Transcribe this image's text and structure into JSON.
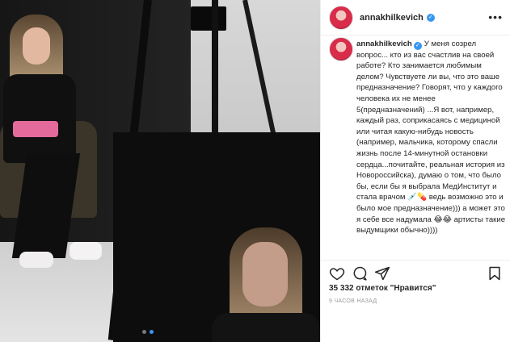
{
  "post": {
    "username": "annakhilkevich",
    "verified_mark": "✓",
    "more_icon": "•••",
    "caption": "У меня созрел вопрос... кто из вас счастлив на своей работе? Кто занимается любимым делом? Чувствуете ли вы, что это ваше предназначение? Говорят, что у каждого человека их не менее 5(предназначений) ...Я вот, например, каждый раз, соприкасаясь с медициной или читая какую-нибудь новость (например, мальчика, которому спасли жизнь после 14-минутной остановки сердца...почитайте, реальная история из Новороссийска), думаю о том, что было бы, если бы я выбрала МедИнститут и стала врачом 💉💊 ведь возможно это и было мое предназначение))) а может это я себе все надумала 😂😂 артисты такие выдумщики обычно))))",
    "likes_text": "35 332 отметок \"Нравится\"",
    "time_text": "9 ЧАСОВ НАЗАД"
  },
  "carousel": {
    "dots": 2,
    "active_index": 1
  },
  "colors": {
    "accent": "#3897f0",
    "text": "#262626",
    "muted": "#999999",
    "border": "#efefef"
  },
  "icons": {
    "header_more": "more-icon",
    "like": "heart-icon",
    "comment": "comment-icon",
    "share": "share-icon",
    "save": "bookmark-icon"
  }
}
